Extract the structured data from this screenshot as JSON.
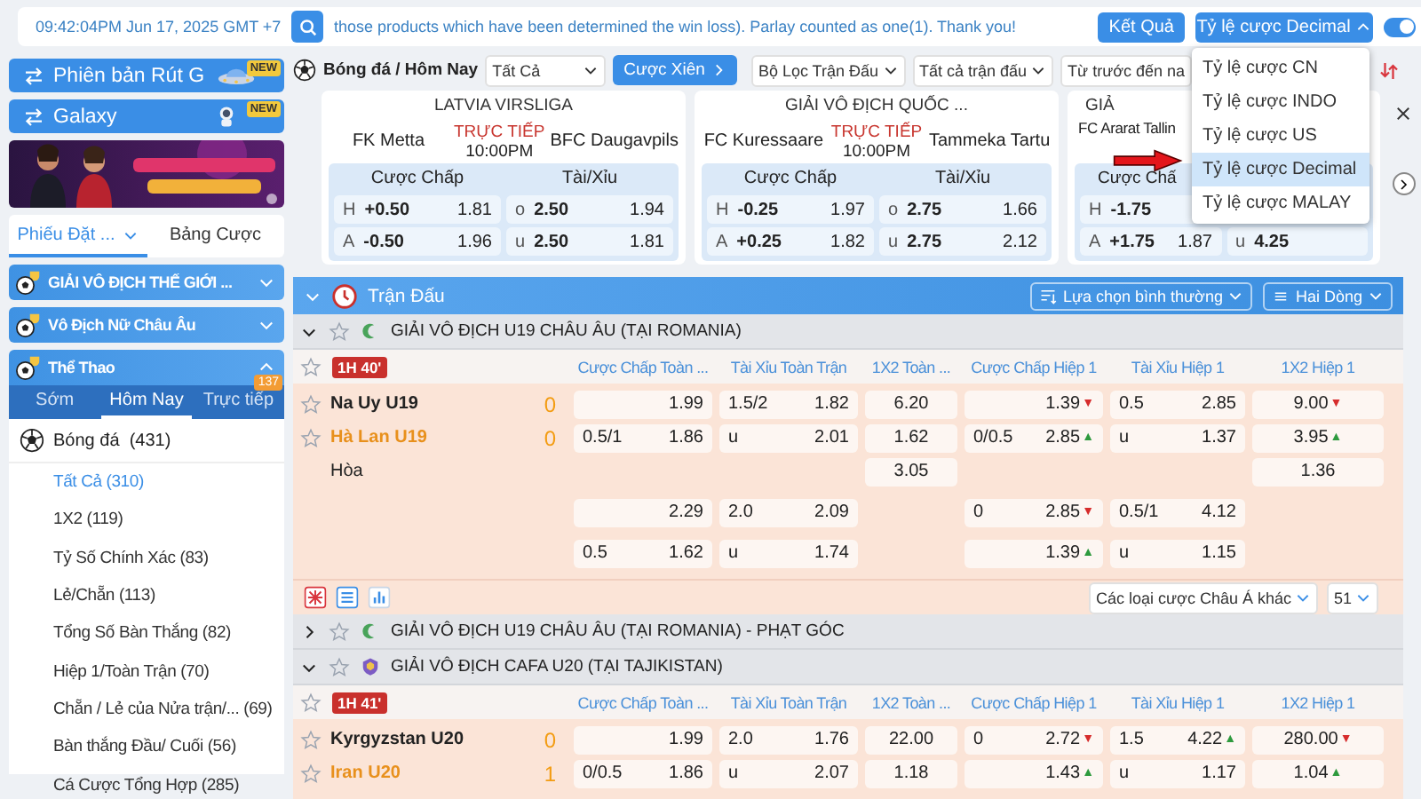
{
  "topbar": {
    "time": "09:42:04PM Jun 17, 2025 GMT +7",
    "notice": "those products which have been determined the win loss). Parlay counted as one(1). Thank you!",
    "results_button": "Kết Quả",
    "odds_format": {
      "label": "Tỷ lệ cược Decimal",
      "expanded": true,
      "options": [
        {
          "label": "Tỷ lệ cược CN",
          "selected": false
        },
        {
          "label": "Tỷ lệ cược INDO",
          "selected": false
        },
        {
          "label": "Tỷ lệ cược US",
          "selected": false
        },
        {
          "label": "Tỷ lệ cược Decimal",
          "selected": true
        },
        {
          "label": "Tỷ lệ cược MALAY",
          "selected": false
        }
      ]
    },
    "toggle": {
      "on": true
    }
  },
  "sidebar": {
    "version_buttons": [
      {
        "label": "Phiên bản Rút G",
        "badge": "NEW"
      },
      {
        "label": "Galaxy",
        "badge": "NEW"
      }
    ],
    "tabs": [
      {
        "label": "Phiếu Đặt ...",
        "selected": true
      },
      {
        "label": "Bảng Cược",
        "selected": false
      }
    ],
    "sections": [
      {
        "title": "GIẢI VÔ ĐỊCH THẾ GIỚI ...",
        "expanded": false
      },
      {
        "title": "Vô Địch Nữ Châu Âu",
        "expanded": false
      },
      {
        "title": "Thể Thao",
        "expanded": true
      }
    ],
    "sport_tabs": [
      {
        "label": "Sớm",
        "selected": false
      },
      {
        "label": "Hôm Nay",
        "selected": true
      },
      {
        "label": "Trực tiếp",
        "selected": false,
        "badge": "137"
      }
    ],
    "sport": "Bóng đá  (431)",
    "markets": [
      {
        "label": "Tất Cả (310)",
        "selected": true
      },
      {
        "label": "1X2 (119)",
        "selected": false
      },
      {
        "label": "Tỷ Số Chính Xác (83)",
        "selected": false
      },
      {
        "label": "Lẻ/Chẵn (113)",
        "selected": false
      },
      {
        "label": "Tổng Số Bàn Thắng (82)",
        "selected": false
      },
      {
        "label": "Hiệp 1/Toàn Trận (70)",
        "selected": false
      },
      {
        "label": "Chẵn / Lẻ của Nửa trận/... (69)",
        "selected": false
      },
      {
        "label": "Bàn thắng Đầu/ Cuối (56)",
        "selected": false
      },
      {
        "label": "Cá Cược Tổng Hợp (285)",
        "selected": false
      }
    ]
  },
  "toolbar": {
    "breadcrumb": "Bóng đá / Hôm Nay",
    "filter": "Tất Cả",
    "parlay_button": "Cược Xiên",
    "dropdowns": [
      "Bộ Lọc Trận Đấu",
      "Tất cả trận đấu",
      "Từ trước đến na"
    ]
  },
  "featured_matches": [
    {
      "kind": "full",
      "league": "LATVIA VIRSLIGA",
      "home": "FK Metta",
      "away": "BFC Daugavpils",
      "status": "TRỰC TIẾP",
      "time": "10:00PM",
      "handicap_label": "Cược Chấp",
      "ou_label": "Tài/Xỉu",
      "lines": [
        {
          "side": "H",
          "hcp": "+0.50",
          "hcp_odds": "1.81",
          "ou_side": "o",
          "ou_line": "2.50",
          "ou_odds": "1.94"
        },
        {
          "side": "A",
          "hcp": "-0.50",
          "hcp_odds": "1.96",
          "ou_side": "u",
          "ou_line": "2.50",
          "ou_odds": "1.81"
        }
      ]
    },
    {
      "kind": "full",
      "league": "GIẢI VÔ ĐỊCH QUỐC ...",
      "home": "FC Kuressaare",
      "away": "Tammeka Tartu",
      "status": "TRỰC TIẾP",
      "time": "10:00PM",
      "handicap_label": "Cược Chấp",
      "ou_label": "Tài/Xỉu",
      "lines": [
        {
          "side": "H",
          "hcp": "-0.25",
          "hcp_odds": "1.97",
          "ou_side": "o",
          "ou_line": "2.75",
          "ou_odds": "1.66"
        },
        {
          "side": "A",
          "hcp": "+0.25",
          "hcp_odds": "1.82",
          "ou_side": "u",
          "ou_line": "2.75",
          "ou_odds": "2.12"
        }
      ]
    },
    {
      "kind": "partial",
      "league": "GIẢ",
      "home": "FC Ararat Tallin",
      "handicap_label": "Cược Chấ",
      "lines": [
        {
          "side": "H",
          "hcp": "-1.75"
        },
        {
          "side": "A",
          "hcp": "+1.75",
          "hcp_odds": "1.87",
          "ou_side": "u",
          "ou_line": "4.25"
        }
      ]
    }
  ],
  "matches_panel": {
    "title": "Trận Đấu",
    "sort_select": "Lựa chọn bình thường",
    "view_select": "Hai Dòng",
    "leagues": [
      {
        "name": "GIẢI VÔ ĐỊCH U19 CHÂU ÂU (TẠI ROMANIA)",
        "expanded": true,
        "matches": [
          {
            "clock": "1H 40'",
            "columns": [
              {
                "label": "Cược Chấp Toàn ...",
                "kind": "line"
              },
              {
                "label": "Tài Xỉu Toàn Trận",
                "kind": "line"
              },
              {
                "label": "1X2 Toàn ...",
                "kind": "single"
              },
              {
                "label": "Cược Chấp Hiệp 1",
                "kind": "line"
              },
              {
                "label": "Tài Xỉu Hiệp 1",
                "kind": "line"
              },
              {
                "label": "1X2 Hiệp 1",
                "kind": "single"
              }
            ],
            "rows": [
              {
                "kind": "home",
                "team": "Na Uy U19",
                "score": "0",
                "cells": [
                  {
                    "odds": "1.99"
                  },
                  {
                    "line": "1.5/2",
                    "odds": "1.82"
                  },
                  {
                    "odds": "6.20"
                  },
                  {
                    "odds": "1.39",
                    "trend": "▼",
                    "color": "#d62c2c"
                  },
                  {
                    "line": "0.5",
                    "odds": "2.85"
                  },
                  {
                    "odds": "9.00",
                    "trend": "▼",
                    "color": "#d62c2c"
                  }
                ]
              },
              {
                "kind": "away",
                "team": "Hà Lan U19",
                "score": "0",
                "cells": [
                  {
                    "line": "0.5/1",
                    "odds": "1.86"
                  },
                  {
                    "line": "u",
                    "odds": "2.01"
                  },
                  {
                    "odds": "1.62"
                  },
                  {
                    "line": "0/0.5",
                    "odds": "2.85",
                    "trend": "▲",
                    "color": "#2e9a3e"
                  },
                  {
                    "line": "u",
                    "odds": "1.37"
                  },
                  {
                    "odds": "3.95",
                    "trend": "▲",
                    "color": "#2e9a3e"
                  }
                ]
              },
              {
                "kind": "draw",
                "team": "Hòa",
                "cells": [
                  null,
                  null,
                  {
                    "odds": "3.05"
                  },
                  null,
                  null,
                  {
                    "odds": "1.36"
                  }
                ]
              },
              {
                "kind": "extra",
                "cells": [
                  {
                    "odds": "2.29"
                  },
                  {
                    "line": "2.0",
                    "odds": "2.09"
                  },
                  null,
                  {
                    "line": "0",
                    "odds": "2.85",
                    "trend": "▼",
                    "color": "#d62c2c"
                  },
                  {
                    "line": "0.5/1",
                    "odds": "4.12"
                  },
                  null
                ]
              },
              {
                "kind": "extra",
                "cells": [
                  {
                    "line": "0.5",
                    "odds": "1.62"
                  },
                  {
                    "line": "u",
                    "odds": "1.74"
                  },
                  null,
                  {
                    "odds": "1.39",
                    "trend": "▲",
                    "color": "#2e9a3e"
                  },
                  {
                    "line": "u",
                    "odds": "1.15"
                  },
                  null
                ]
              }
            ]
          }
        ],
        "footer": {
          "market_select": "Các loại cược Châu Á khác",
          "count_select": "51"
        }
      },
      {
        "name": "GIẢI VÔ ĐỊCH U19 CHÂU ÂU (TẠI ROMANIA) - PHẠT GÓC",
        "expanded": false
      },
      {
        "name": "GIẢI VÔ ĐỊCH CAFA U20 (TẠI TAJIKISTAN)",
        "expanded": true,
        "matches": [
          {
            "clock": "1H 41'",
            "columns": [
              {
                "label": "Cược Chấp Toàn ...",
                "kind": "line"
              },
              {
                "label": "Tài Xỉu Toàn Trận",
                "kind": "line"
              },
              {
                "label": "1X2 Toàn ...",
                "kind": "single"
              },
              {
                "label": "Cược Chấp Hiệp 1",
                "kind": "line"
              },
              {
                "label": "Tài Xỉu Hiệp 1",
                "kind": "line"
              },
              {
                "label": "1X2 Hiệp 1",
                "kind": "single"
              }
            ],
            "rows": [
              {
                "kind": "home",
                "team": "Kyrgyzstan U20",
                "score": "0",
                "cells": [
                  {
                    "odds": "1.99"
                  },
                  {
                    "line": "2.0",
                    "odds": "1.76"
                  },
                  {
                    "odds": "22.00"
                  },
                  {
                    "line": "0",
                    "odds": "2.72",
                    "trend": "▼",
                    "color": "#d62c2c"
                  },
                  {
                    "line": "1.5",
                    "odds": "4.22",
                    "trend": "▲",
                    "color": "#2e9a3e"
                  },
                  {
                    "odds": "280.00",
                    "trend": "▼",
                    "color": "#d62c2c"
                  }
                ]
              },
              {
                "kind": "away",
                "team": "Iran U20",
                "score": "1",
                "cells": [
                  {
                    "line": "0/0.5",
                    "odds": "1.86"
                  },
                  {
                    "line": "u",
                    "odds": "2.07"
                  },
                  {
                    "odds": "1.18"
                  },
                  {
                    "odds": "1.43",
                    "trend": "▲",
                    "color": "#2e9a3e"
                  },
                  {
                    "line": "u",
                    "odds": "1.17"
                  },
                  {
                    "odds": "1.04",
                    "trend": "▲",
                    "color": "#2e9a3e"
                  }
                ]
              }
            ]
          }
        ]
      }
    ]
  }
}
